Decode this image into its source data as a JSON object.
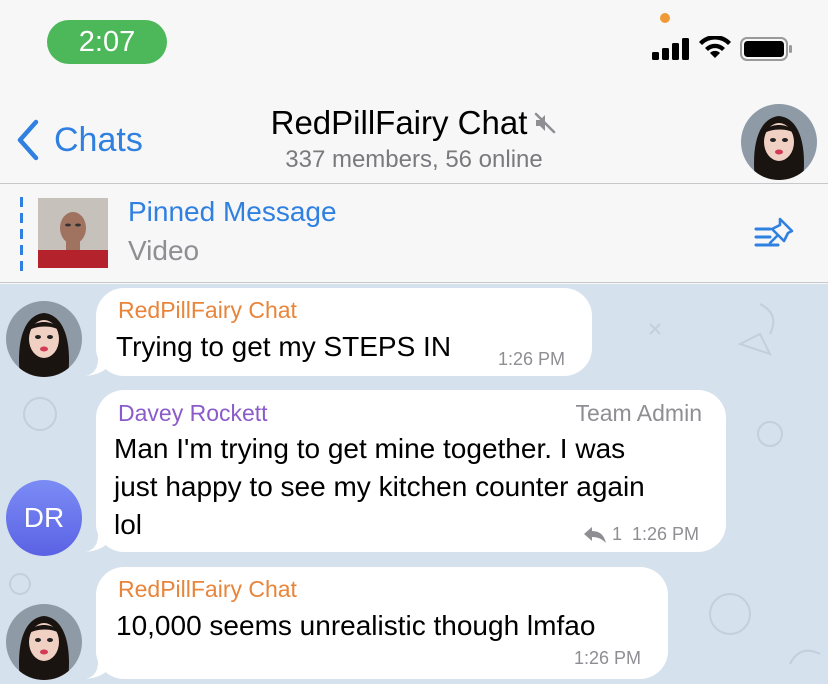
{
  "status_bar": {
    "time": "2:07"
  },
  "header": {
    "back_label": "Chats",
    "title": "RedPillFairy Chat",
    "subtitle": "337 members, 56 online"
  },
  "pinned": {
    "title": "Pinned Message",
    "subtitle": "Video"
  },
  "messages": [
    {
      "sender": "RedPillFairy Chat",
      "text": "Trying to get my STEPS IN",
      "time": "1:26 PM",
      "sender_color": "#e8853a"
    },
    {
      "sender": "Davey Rockett",
      "role": "Team Admin",
      "avatar_initials": "DR",
      "text_lines": [
        "Man I'm trying to get mine together. I was",
        "just happy to see my kitchen counter again",
        "lol"
      ],
      "replies": "1",
      "time": "1:26 PM",
      "sender_color": "#8b5cc9"
    },
    {
      "sender": "RedPillFairy Chat",
      "text": "10,000 seems unrealistic though lmfao",
      "time": "1:26 PM",
      "sender_color": "#e8853a"
    }
  ],
  "icons": {
    "back": "chevron-left-icon",
    "mute": "mute-icon",
    "pinned_list": "pinned-list-icon",
    "reply": "reply-icon"
  },
  "colors": {
    "accent": "#2f80e0",
    "time_pill": "#4cb85a",
    "chat_bg": "#d5e1ec"
  }
}
